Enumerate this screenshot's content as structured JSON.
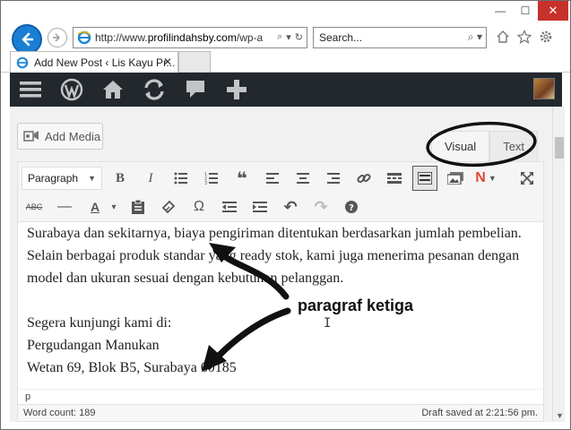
{
  "browser": {
    "url_prefix": "http://www.",
    "url_domain": "profilindahsby.com",
    "url_suffix": "/wp-a",
    "search_placeholder": "Search...",
    "tab_title": "Add New Post ‹ Lis Kayu Pr...",
    "icons": [
      "back-arrow-icon",
      "forward-arrow-icon",
      "ie-logo-icon",
      "search-icon",
      "home-icon",
      "star-icon",
      "gear-icon"
    ]
  },
  "window_controls": {
    "minimize": "—",
    "maximize": "☐",
    "close": "✕"
  },
  "wp_admin_bar": {
    "icons": [
      "menu-icon",
      "wordpress-logo-icon",
      "home-icon",
      "refresh-icon",
      "comment-icon",
      "plus-icon"
    ]
  },
  "editor": {
    "add_media_label": "Add Media",
    "mode_tabs": {
      "visual": "Visual",
      "text": "Text"
    },
    "format_select": "Paragraph",
    "toolbar_row1": [
      "B",
      "I",
      "•≡",
      "1≡",
      "❝",
      "≡",
      "≡",
      "≡",
      "🔗",
      "▬",
      "▦",
      "▣",
      "N"
    ],
    "toolbar_row2": [
      "ABC",
      "—",
      "A",
      "▾",
      "📋",
      "◇",
      "Ω",
      "⇤",
      "⇥",
      "↶",
      "↷",
      "?"
    ],
    "content": {
      "para1": "Surabaya dan sekitarnya, biaya pengiriman ditentukan berdasarkan jumlah pembelian. Selain berbagai produk standar yang ready stok, kami juga menerima pesanan dengan model dan ukuran sesuai dengan kebutuhan pelanggan.",
      "line1": "Segera kunjungi kami di:",
      "line2": "Pergudangan Manukan",
      "line3": "Wetan 69, Blok B5, Surabaya 60185"
    },
    "path": "p",
    "word_count": "Word count: 189",
    "draft_saved": "Draft saved at 2:21:56 pm."
  },
  "annotation": {
    "label": "paragraf ketiga"
  }
}
